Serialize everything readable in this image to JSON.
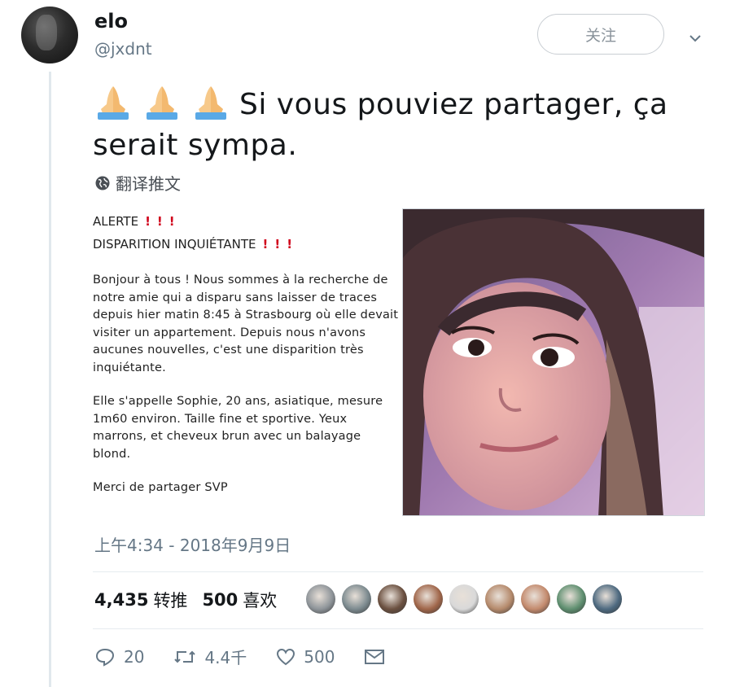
{
  "user": {
    "name": "elo",
    "handle": "@jxdnt",
    "follow_label": "关注"
  },
  "tweet": {
    "emoji_name": "folded-hands",
    "text": "Si vous pouviez partager, ça serait sympa.",
    "translate_label": "翻译推文",
    "timestamp": "上午4:34 - 2018年9月9日"
  },
  "notice": {
    "alert_line": "ALERTE",
    "disappearance_line": "DISPARITION INQUIÉTANTE",
    "paragraph1": "Bonjour à tous ! Nous sommes à la recherche de notre amie qui a disparu sans laisser de traces depuis hier matin 8:45 à Strasbourg où elle devait visiter un appartement. Depuis nous n'avons aucunes nouvelles, c'est une disparition très inquiétante.",
    "paragraph2": "Elle s'appelle Sophie, 20 ans, asiatique, mesure 1m60 environ. Taille fine et sportive. Yeux marrons, et cheveux brun avec un balayage blond.",
    "paragraph3": "Merci de partager SVP"
  },
  "stats": {
    "retweets_count": "4,435",
    "retweets_label": "转推",
    "likes_count": "500",
    "likes_label": "喜欢"
  },
  "likers": [
    {
      "color": "#8e9499"
    },
    {
      "color": "#7c8a8f"
    },
    {
      "color": "#6b5040"
    },
    {
      "color": "#a0664a"
    },
    {
      "color": "#d9d9d9"
    },
    {
      "color": "#b58a6c"
    },
    {
      "color": "#c38a6d"
    },
    {
      "color": "#5f8f70"
    },
    {
      "color": "#4e6a80"
    }
  ],
  "actions": {
    "replies": "20",
    "retweets": "4.4千",
    "likes": "500"
  },
  "colors": {
    "secondary_text": "#657786",
    "alert_red": "#d0021b",
    "divider": "#e6ecf0"
  }
}
